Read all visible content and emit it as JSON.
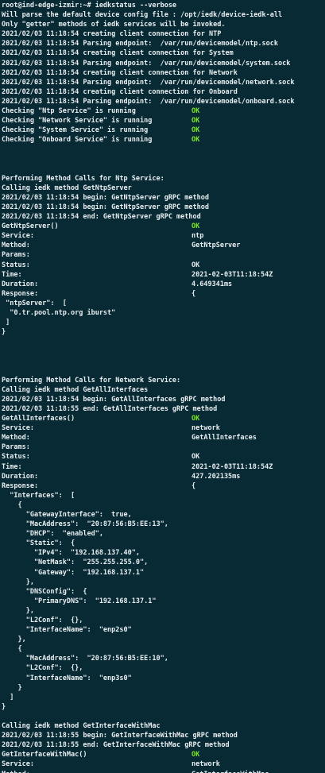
{
  "colors": {
    "background": "#072a35",
    "text": "#e9eef0",
    "ok": "#7ee82c"
  },
  "terminal": {
    "lines": [
      {
        "text": "root@ind-edge-izmir:~# iedkstatus --verbose"
      },
      {
        "text": "Will parse the default device config file : /opt/iedk/device-iedk-all"
      },
      {
        "text": "Only \"getter\" methods of iedk services will be invoked."
      },
      {
        "text": "2021/02/03 11:18:54 creating client connection for NTP"
      },
      {
        "text": "2021/02/03 11:18:54 Parsing endpoint:  /var/run/devicemodel/ntp.sock"
      },
      {
        "text": "2021/02/03 11:18:54 creating client connection for System"
      },
      {
        "text": "2021/02/03 11:18:54 Parsing endpoint:  /var/run/devicemodel/system.sock"
      },
      {
        "text": "2021/02/03 11:18:54 creating client connection for Network"
      },
      {
        "text": "2021/02/03 11:18:54 Parsing endpoint:  /var/run/devicemodel/network.sock"
      },
      {
        "text": "2021/02/03 11:18:54 creating client connection for Onboard"
      },
      {
        "text": "2021/02/03 11:18:54 Parsing endpoint:  /var/run/devicemodel/onboard.sock"
      },
      {
        "text": "Checking \"Ntp Service\" is running",
        "value": "OK",
        "ok": true
      },
      {
        "text": "Checking \"Network Service\" is running",
        "value": "OK",
        "ok": true
      },
      {
        "text": "Checking \"System Service\" is running",
        "value": "OK",
        "ok": true
      },
      {
        "text": "Checking \"Onboard Service\" is running",
        "value": "OK",
        "ok": true
      },
      {
        "text": ""
      },
      {
        "text": ""
      },
      {
        "text": ""
      },
      {
        "text": "Performing Method Calls for Ntp Service:"
      },
      {
        "text": "Calling iedk method GetNtpServer"
      },
      {
        "text": "2021/02/03 11:18:54 begin: GetNtpServer gRPC method"
      },
      {
        "text": "2021/02/03 11:18:54 begin: GetNtpServer gRPC method"
      },
      {
        "text": "2021/02/03 11:18:54 end: GetNtpServer gRPC method"
      },
      {
        "text": "GetNtpServer()",
        "value": "OK",
        "ok": true
      },
      {
        "text": "Service:",
        "value": "ntp"
      },
      {
        "text": "Method:",
        "value": "GetNtpServer"
      },
      {
        "text": "Params:"
      },
      {
        "text": "Status:",
        "value": "OK"
      },
      {
        "text": "Time:",
        "value": "2021-02-03T11:18:54Z"
      },
      {
        "text": "Duration:",
        "value": "4.649341ms"
      },
      {
        "text": "Response:",
        "value": "{"
      },
      {
        "text": " \"ntpServer\":  ["
      },
      {
        "text": "  \"0.tr.pool.ntp.org iburst\""
      },
      {
        "text": " ]"
      },
      {
        "text": "}"
      },
      {
        "text": ""
      },
      {
        "text": ""
      },
      {
        "text": ""
      },
      {
        "text": ""
      },
      {
        "text": "Performing Method Calls for Network Service:"
      },
      {
        "text": "Calling iedk method GetAllInterfaces"
      },
      {
        "text": "2021/02/03 11:18:54 begin: GetAllInterfaces gRPC method"
      },
      {
        "text": "2021/02/03 11:18:55 end: GetAllInterfaces gRPC method"
      },
      {
        "text": "GetAllInterfaces()",
        "value": "OK",
        "ok": true
      },
      {
        "text": "Service:",
        "value": "network"
      },
      {
        "text": "Method:",
        "value": "GetAllInterfaces"
      },
      {
        "text": "Params:"
      },
      {
        "text": "Status:",
        "value": "OK"
      },
      {
        "text": "Time:",
        "value": "2021-02-03T11:18:54Z"
      },
      {
        "text": "Duration:",
        "value": "427.202135ms"
      },
      {
        "text": "Response:",
        "value": "{"
      },
      {
        "text": "  \"Interfaces\":  ["
      },
      {
        "text": "    {"
      },
      {
        "text": "      \"GatewayInterface\":  true,"
      },
      {
        "text": "      \"MacAddress\":  \"20:87:56:B5:EE:13\","
      },
      {
        "text": "      \"DHCP\":  \"enabled\","
      },
      {
        "text": "      \"Static\":  {"
      },
      {
        "text": "        \"IPv4\":  \"192.168.137.40\","
      },
      {
        "text": "        \"NetMask\":  \"255.255.255.0\","
      },
      {
        "text": "        \"Gateway\":  \"192.168.137.1\""
      },
      {
        "text": "      },"
      },
      {
        "text": "      \"DNSConfig\":  {"
      },
      {
        "text": "        \"PrimaryDNS\":  \"192.168.137.1\""
      },
      {
        "text": "      },"
      },
      {
        "text": "      \"L2Conf\":  {},"
      },
      {
        "text": "      \"InterfaceName\":  \"enp2s0\""
      },
      {
        "text": "    },"
      },
      {
        "text": "    {"
      },
      {
        "text": "      \"MacAddress\":  \"20:87:56:B5:EE:10\","
      },
      {
        "text": "      \"L2Conf\":  {},"
      },
      {
        "text": "      \"InterfaceName\":  \"enp3s0\""
      },
      {
        "text": "    }"
      },
      {
        "text": "  ]"
      },
      {
        "text": "}"
      },
      {
        "text": ""
      },
      {
        "text": "Calling iedk method GetInterfaceWithMac"
      },
      {
        "text": "2021/02/03 11:18:55 begin: GetInterfaceWithMac gRPC method"
      },
      {
        "text": "2021/02/03 11:18:55 end: GetInterfaceWithMac gRPC method"
      },
      {
        "text": "GetInterfaceWithMac()",
        "value": "OK",
        "ok": true
      },
      {
        "text": "Service:",
        "value": "network"
      },
      {
        "text": "Method:",
        "value": "GetInterfaceWithMac"
      }
    ]
  }
}
